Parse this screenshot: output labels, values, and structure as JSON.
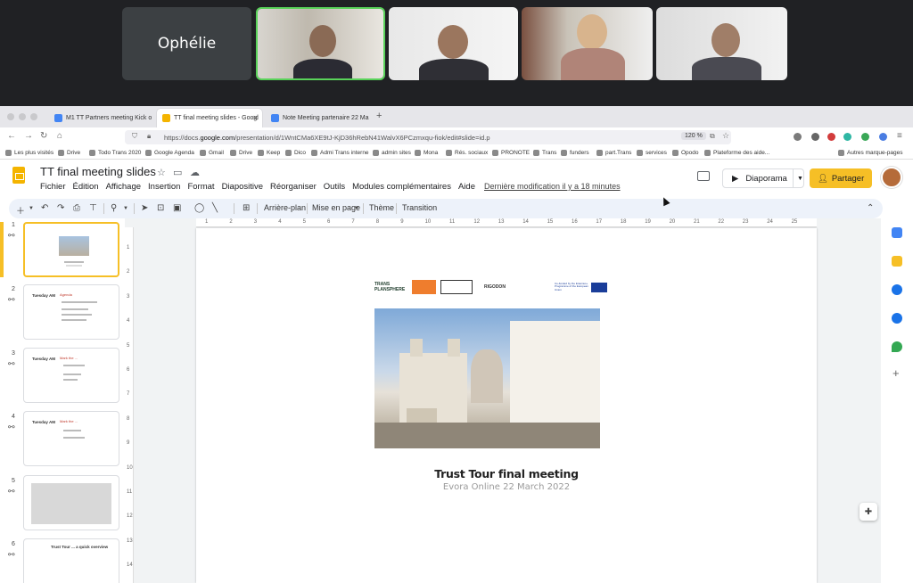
{
  "meeting": {
    "name_tile": "Ophélie"
  },
  "browser": {
    "tabs": [
      {
        "label": "M1 TT Partners meeting Kick o",
        "color": "#4285f4"
      },
      {
        "label": "TT final meeting slides - Googl",
        "color": "#f4b400"
      },
      {
        "label": "Note Meeting partenaire 22 Ma",
        "color": "#4285f4"
      }
    ],
    "url_prefix": "https://docs.",
    "url_domain": "google.com",
    "url_rest": "/presentation/d/1WntCMa6XE9tJ-KjD36hRebN41WalvX6PCzmxqu-fiok/edit#slide=id.p",
    "zoom": "120 %",
    "bookmarks": [
      "Les plus visités",
      "Drive",
      "Todo Trans 2020",
      "Google Agenda",
      "Gmail",
      "Drive",
      "Keep",
      "Dico",
      "Admi Trans interne",
      "admin sites",
      "Mona",
      "Rés. sociaux",
      "PRONOTE",
      "Trans",
      "funders",
      "part.Trans",
      "services",
      "Opodo",
      "Plateforme des aide...",
      "Autres marque-pages"
    ]
  },
  "app": {
    "title": "TT final meeting slides",
    "menu": [
      "Fichier",
      "Édition",
      "Affichage",
      "Insertion",
      "Format",
      "Diapositive",
      "Réorganiser",
      "Outils",
      "Modules complémentaires",
      "Aide"
    ],
    "last_modified": "Dernière modification il y a 18 minutes",
    "slideshow_label": "Diaporama",
    "share_label": "Partager",
    "toolbar": {
      "background": "Arrière-plan",
      "layout": "Mise en page",
      "theme": "Thème",
      "transition": "Transition"
    }
  },
  "filmstrip": {
    "slides": [
      {
        "num": "1",
        "title": "",
        "red": ""
      },
      {
        "num": "2",
        "title": "Tuesday AM",
        "red": "Agenda"
      },
      {
        "num": "3",
        "title": "Tuesday AM",
        "red": "Mark the ..."
      },
      {
        "num": "4",
        "title": "Tuesday AM",
        "red": "Mark the ..."
      },
      {
        "num": "5",
        "title": "",
        "red": ""
      },
      {
        "num": "6",
        "title": "Trust Tour ... a quick overview",
        "red": ""
      }
    ]
  },
  "ruler": {
    "h": [
      "1",
      "2",
      "3",
      "4",
      "5",
      "6",
      "7",
      "8",
      "9",
      "10",
      "11",
      "12",
      "13",
      "14",
      "15",
      "16",
      "17",
      "18",
      "19",
      "20",
      "21",
      "22",
      "23",
      "24",
      "25"
    ],
    "v": [
      "1",
      "2",
      "3",
      "4",
      "5",
      "6",
      "7",
      "8",
      "9",
      "10",
      "11",
      "12",
      "13",
      "14"
    ]
  },
  "slide": {
    "logos": [
      {
        "text": "TRANS PLANSPHERE",
        "bg": "#ffffff",
        "fg": "#1d3b2a"
      },
      {
        "text": "",
        "bg": "#ef7d2d",
        "fg": "#ffffff"
      },
      {
        "text": "",
        "bg": "#ffffff",
        "fg": "#222222"
      },
      {
        "text": "RIGODON",
        "bg": "#ffffff",
        "fg": "#333333"
      },
      {
        "text": "Co-funded by the Erasmus+ Programme of the European Union",
        "bg": "#ffffff",
        "fg": "#1a3d99"
      }
    ],
    "title": "Trust Tour final meeting",
    "subtitle": "Evora Online 22 March 2022"
  },
  "colors": {
    "accent": "#f6bf26",
    "active_speaker": "#5ad35a"
  }
}
